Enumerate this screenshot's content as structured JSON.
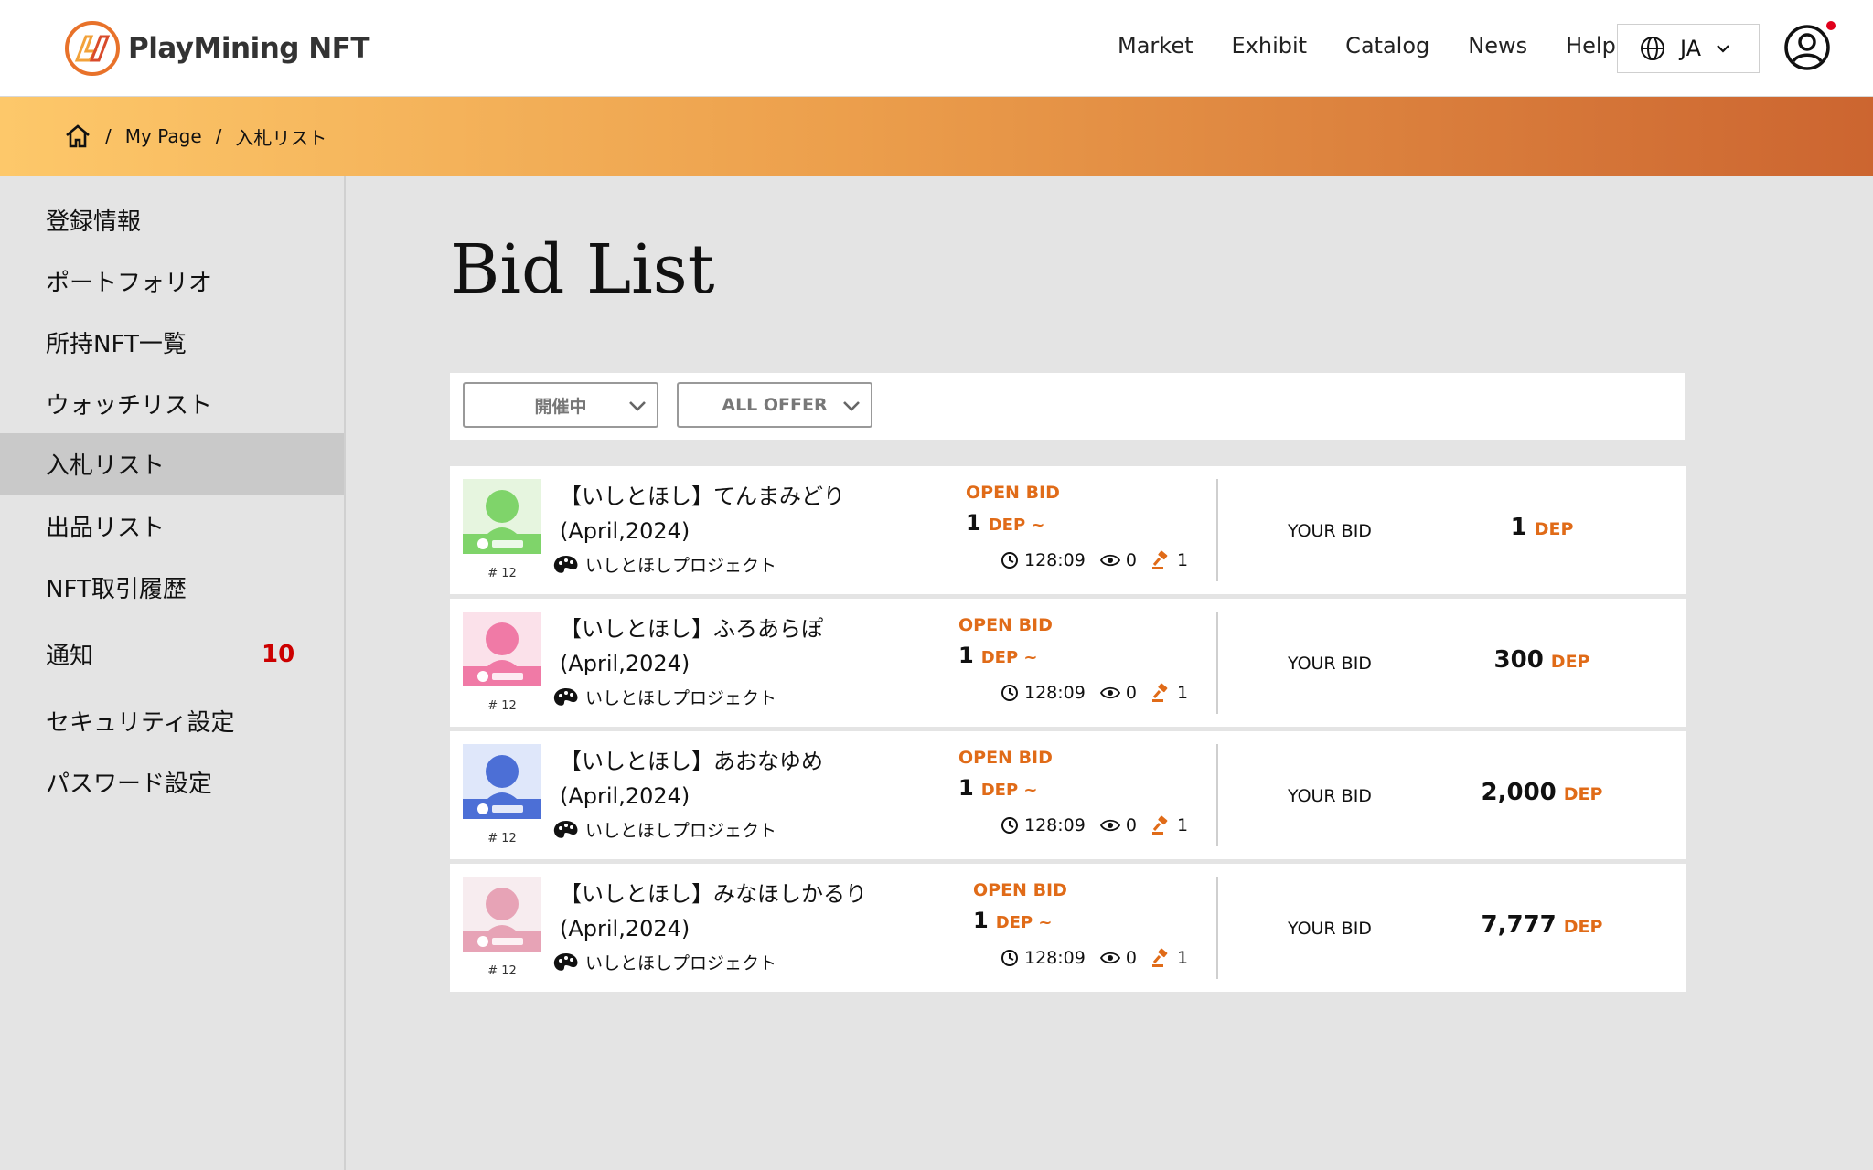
{
  "header": {
    "brand": "PlayMining NFT",
    "nav": [
      "Market",
      "Exhibit",
      "Catalog",
      "News",
      "Help"
    ],
    "language": "JA"
  },
  "breadcrumb": {
    "home_icon": "home-icon",
    "items": [
      "My Page",
      "入札リスト"
    ]
  },
  "sidebar": {
    "items": [
      {
        "label": "登録情報"
      },
      {
        "label": "ポートフォリオ"
      },
      {
        "label": "所持NFT一覧"
      },
      {
        "label": "ウォッチリスト"
      },
      {
        "label": "入札リスト",
        "active": true
      },
      {
        "label": "出品リスト"
      },
      {
        "label": "NFT取引履歴"
      },
      {
        "label": "通知",
        "badge": "10"
      },
      {
        "label": "セキュリティ設定"
      },
      {
        "label": "パスワード設定"
      }
    ]
  },
  "page": {
    "title": "Bid List"
  },
  "filters": {
    "status": "開催中",
    "offer": "ALL OFFER"
  },
  "bids": [
    {
      "title": "【いしとほし】てんまみどり",
      "title2": "(April,2024)",
      "number": "# 12",
      "creator": "いしとほしプロジェクト",
      "status": "OPEN BID",
      "start_price": "1",
      "start_unit": "DEP ~",
      "time": "128:09",
      "views": "0",
      "bids": "1",
      "your_bid_label": "YOUR BID",
      "your_bid": "1",
      "your_bid_unit": "DEP",
      "thumb_color": "#7fd46a",
      "thumb_bg": "#e6f5df"
    },
    {
      "title": "【いしとほし】ふろあらぽ",
      "title2": "(April,2024)",
      "number": "# 12",
      "creator": "いしとほしプロジェクト",
      "status": "OPEN BID",
      "start_price": "1",
      "start_unit": "DEP ~",
      "time": "128:09",
      "views": "0",
      "bids": "1",
      "your_bid_label": "YOUR BID",
      "your_bid": "300",
      "your_bid_unit": "DEP",
      "thumb_color": "#f07aa6",
      "thumb_bg": "#fbe1ea"
    },
    {
      "title": "【いしとほし】あおなゆめ",
      "title2": "(April,2024)",
      "number": "# 12",
      "creator": "いしとほしプロジェクト",
      "status": "OPEN BID",
      "start_price": "1",
      "start_unit": "DEP ~",
      "time": "128:09",
      "views": "0",
      "bids": "1",
      "your_bid_label": "YOUR BID",
      "your_bid": "2,000",
      "your_bid_unit": "DEP",
      "thumb_color": "#4c6fd6",
      "thumb_bg": "#dfe7fa"
    },
    {
      "title": "【いしとほし】みなほしかるり",
      "title2": "(April,2024)",
      "number": "# 12",
      "creator": "いしとほしプロジェクト",
      "status": "OPEN BID",
      "start_price": "1",
      "start_unit": "DEP ~",
      "time": "128:09",
      "views": "0",
      "bids": "1",
      "your_bid_label": "YOUR BID",
      "your_bid": "7,777",
      "your_bid_unit": "DEP",
      "thumb_color": "#e7a3b6",
      "thumb_bg": "#f7ecef"
    }
  ],
  "colors": {
    "accent": "#e06b18",
    "badge": "#cc0000",
    "gradient_start": "#fdc86a",
    "gradient_end": "#cc6530"
  }
}
